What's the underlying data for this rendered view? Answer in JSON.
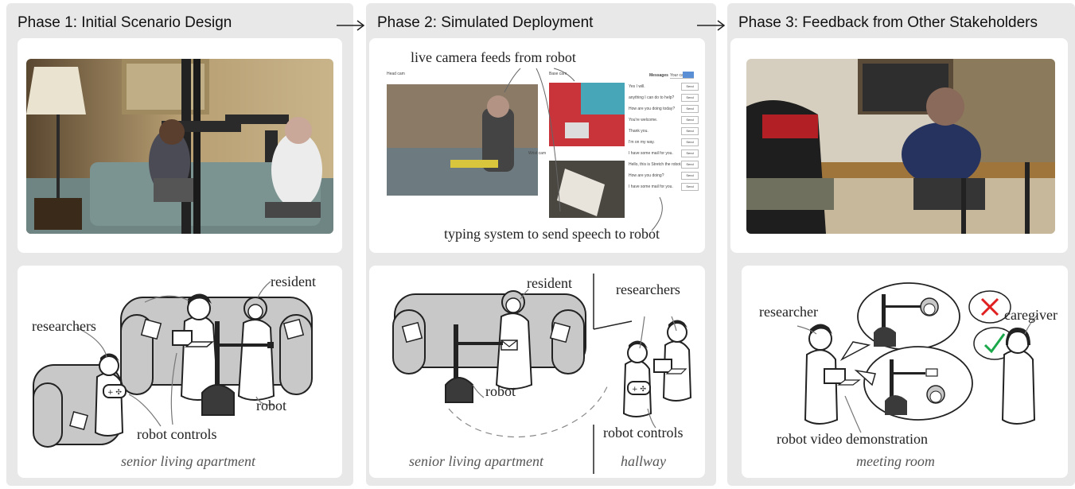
{
  "phases": [
    {
      "title": "Phase 1: Initial Scenario Design"
    },
    {
      "title": "Phase 2: Simulated Deployment"
    },
    {
      "title": "Phase 3: Feedback from Other Stakeholders"
    }
  ],
  "phase1": {
    "labels": {
      "resident": "resident",
      "researchers": "researchers",
      "robot": "robot",
      "robot_controls": "robot controls",
      "location": "senior living apartment"
    }
  },
  "phase2": {
    "annotations": {
      "camera": "live camera feeds from robot",
      "typing": "typing system to send speech to robot"
    },
    "ui": {
      "head_cam": "Head cam",
      "base_cam": "Base cam",
      "wrist_cam": "Wrist cam",
      "messages_label": "Messages",
      "message_input_placeholder": "Your call",
      "send_label": "Send",
      "messages": [
        "Yes I will.",
        "anything I can do to help?",
        "How are you doing today?",
        "You're welcome.",
        "Thank you.",
        "I'm on my way.",
        "I have some mail for you.",
        "Hello, this is Stretch the robot.",
        "How are you doing?",
        "I have some mail for you."
      ]
    },
    "labels": {
      "resident": "resident",
      "researchers": "researchers",
      "robot": "robot",
      "robot_controls": "robot controls",
      "location_left": "senior living apartment",
      "location_right": "hallway"
    }
  },
  "phase3": {
    "labels": {
      "researcher": "researcher",
      "caregiver": "caregiver",
      "video_demo": "robot video demonstration",
      "location": "meeting room"
    }
  },
  "colors": {
    "panel_bg": "#e8e8e8",
    "card_bg": "#ffffff",
    "sofa": "#c8c8c8",
    "robot_dark": "#333333",
    "cross_red": "#e02020",
    "check_green": "#1aa84a"
  }
}
